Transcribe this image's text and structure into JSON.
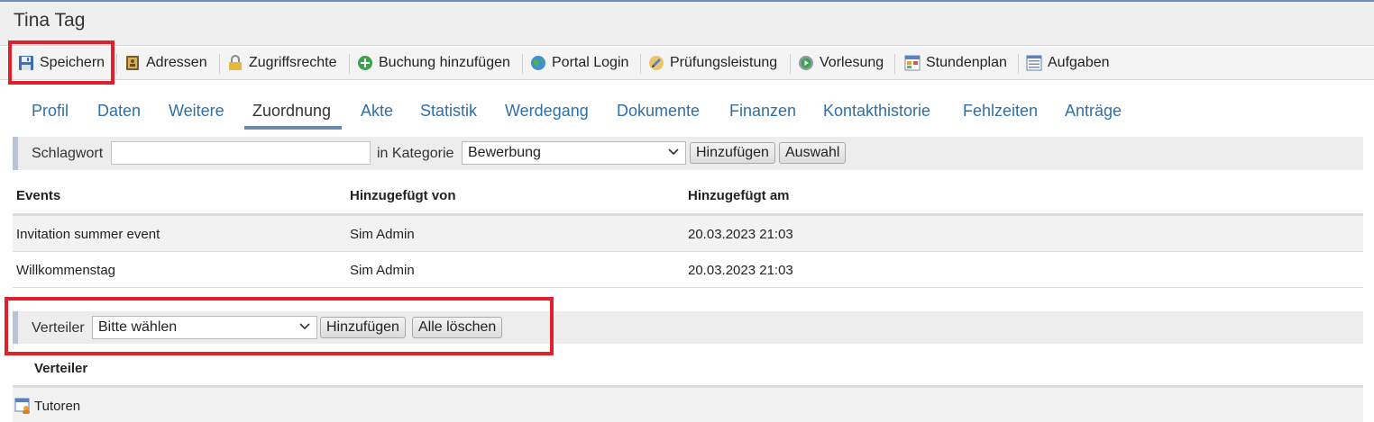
{
  "window_title": "Tina Tag",
  "toolbar": {
    "items": [
      {
        "label": "Speichern",
        "icon": "save-icon"
      },
      {
        "label": "Adressen",
        "icon": "address-book-icon"
      },
      {
        "label": "Zugriffsrechte",
        "icon": "lock-icon"
      },
      {
        "label": "Buchung hinzufügen",
        "icon": "add-circle-icon"
      },
      {
        "label": "Portal Login",
        "icon": "globe-icon"
      },
      {
        "label": "Prüfungsleistung",
        "icon": "pencil-icon"
      },
      {
        "label": "Vorlesung",
        "icon": "lecture-play-icon"
      },
      {
        "label": "Stundenplan",
        "icon": "timetable-icon"
      },
      {
        "label": "Aufgaben",
        "icon": "task-list-icon"
      }
    ]
  },
  "tabs": [
    {
      "label": "Profil"
    },
    {
      "label": "Daten"
    },
    {
      "label": "Weitere"
    },
    {
      "label": "Zuordnung",
      "active": true
    },
    {
      "label": "Akte"
    },
    {
      "label": "Statistik"
    },
    {
      "label": "Werdegang"
    },
    {
      "label": "Dokumente"
    },
    {
      "label": "Finanzen"
    },
    {
      "label": "Kontakthistorie"
    },
    {
      "label": "Fehlzeiten"
    },
    {
      "label": "Anträge"
    }
  ],
  "tag_bar": {
    "keyword_label": "Schlagwort",
    "keyword_value": "",
    "category_label": "in Kategorie",
    "category_selected": "Bewerbung",
    "add_button": "Hinzufügen",
    "select_button": "Auswahl"
  },
  "events_table": {
    "columns": [
      "Events",
      "Hinzugefügt von",
      "Hinzugefügt am"
    ],
    "rows": [
      [
        "Invitation summer event",
        "Sim Admin",
        "20.03.2023 21:03"
      ],
      [
        "Willkommenstag",
        "Sim Admin",
        "20.03.2023 21:03"
      ]
    ]
  },
  "distributor_bar": {
    "label": "Verteiler",
    "selected": "Bitte wählen",
    "add_button": "Hinzufügen",
    "clear_button": "Alle löschen"
  },
  "distributor_list": {
    "header": "Verteiler",
    "items": [
      {
        "label": "Tutoren",
        "icon": "group-calendar-icon"
      }
    ]
  },
  "colors": {
    "link": "#2e6fa8",
    "active_tab_underline": "#6e8aa9",
    "highlight_box": "#e0212b"
  }
}
